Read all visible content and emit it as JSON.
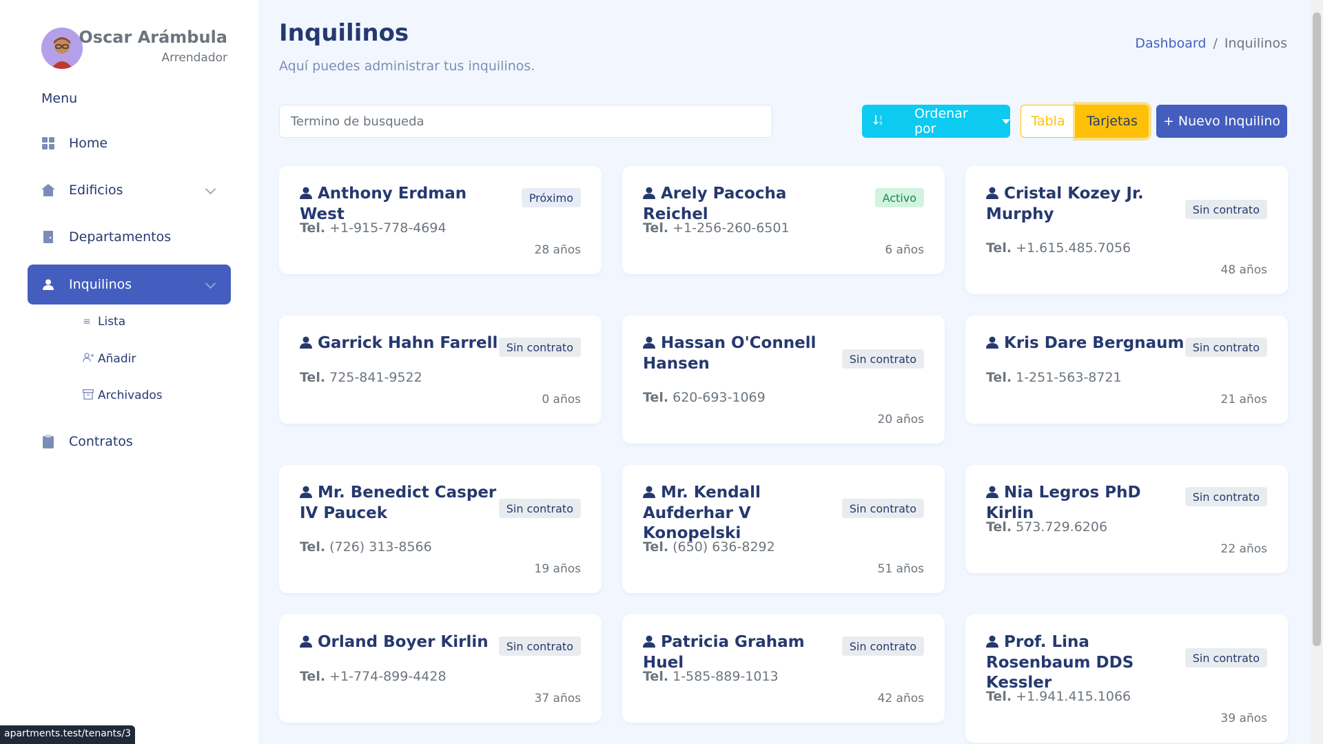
{
  "user": {
    "name": "Oscar Arámbula",
    "role": "Arrendador"
  },
  "sidebar": {
    "menu_title": "Menu",
    "items": [
      {
        "label": "Home",
        "icon": "grid-icon"
      },
      {
        "label": "Edificios",
        "icon": "building-icon"
      },
      {
        "label": "Departamentos",
        "icon": "door-icon"
      },
      {
        "label": "Inquilinos",
        "icon": "person-icon"
      },
      {
        "label": "Contratos",
        "icon": "clipboard-icon"
      }
    ],
    "subitems": [
      {
        "label": "Lista",
        "icon": "list-icon"
      },
      {
        "label": "Añadir",
        "icon": "person-add-icon"
      },
      {
        "label": "Archivados",
        "icon": "archive-icon"
      }
    ]
  },
  "header": {
    "title": "Inquilinos",
    "subtitle": "Aquí puedes administrar tus inquilinos.",
    "breadcrumb": {
      "link": "Dashboard",
      "separator": "/",
      "current": "Inquilinos"
    }
  },
  "toolbar": {
    "search_placeholder": "Termino de busqueda",
    "sort_label": "Ordenar por",
    "view_table": "Tabla",
    "view_cards": "Tarjetas",
    "new_tenant": "+ Nuevo Inquilino"
  },
  "tel_label": "Tel.",
  "tenants": [
    {
      "name": "Anthony Erdman West",
      "phone": "+1-915-778-4694",
      "age": "28 años",
      "status": "Próximo"
    },
    {
      "name": "Arely Pacocha Reichel",
      "phone": "+1-256-260-6501",
      "age": "6 años",
      "status": "Activo"
    },
    {
      "name": "Cristal Kozey Jr. Murphy",
      "phone": "+1.615.485.7056",
      "age": "48 años",
      "status": "Sin contrato"
    },
    {
      "name": "Garrick Hahn Farrell",
      "phone": "725-841-9522",
      "age": "0 años",
      "status": "Sin contrato"
    },
    {
      "name": "Hassan O'Connell Hansen",
      "phone": "620-693-1069",
      "age": "20 años",
      "status": "Sin contrato"
    },
    {
      "name": "Kris Dare Bergnaum",
      "phone": "1-251-563-8721",
      "age": "21 años",
      "status": "Sin contrato"
    },
    {
      "name": "Mr. Benedict Casper IV Paucek",
      "phone": "(726) 313-8566",
      "age": "19 años",
      "status": "Sin contrato"
    },
    {
      "name": "Mr. Kendall Aufderhar V Konopelski",
      "phone": "(650) 636-8292",
      "age": "51 años",
      "status": "Sin contrato"
    },
    {
      "name": "Nia Legros PhD Kirlin",
      "phone": "573.729.6206",
      "age": "22 años",
      "status": "Sin contrato"
    },
    {
      "name": "Orland Boyer Kirlin",
      "phone": "+1-774-899-4428",
      "age": "37 años",
      "status": "Sin contrato"
    },
    {
      "name": "Patricia Graham Huel",
      "phone": "1-585-889-1013",
      "age": "42 años",
      "status": "Sin contrato"
    },
    {
      "name": "Prof. Lina Rosenbaum DDS Kessler",
      "phone": "+1.941.415.1066",
      "age": "39 años",
      "status": "Sin contrato"
    }
  ],
  "status_url": "apartments.test/tenants/3",
  "colors": {
    "primary": "#435ebe",
    "info": "#0dcaf0",
    "warning": "#ffc107",
    "background": "#f2f7ff"
  }
}
